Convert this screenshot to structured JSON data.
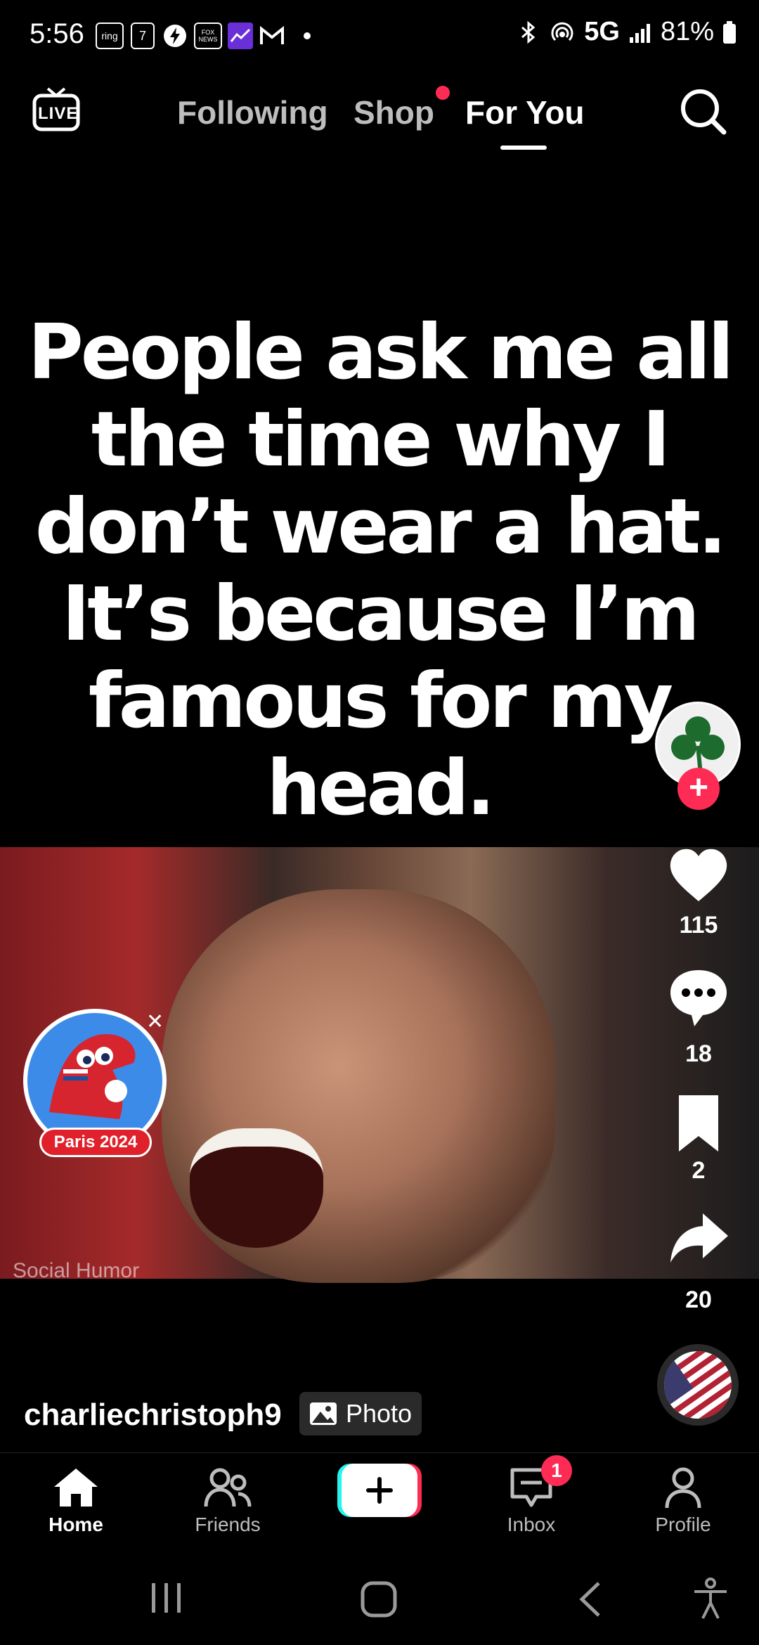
{
  "status_bar": {
    "time": "5:56",
    "notif_icons": [
      "ring-icon",
      "calendar-icon",
      "bolt-icon",
      "fox-news-icon",
      "stocks-icon",
      "gmail-icon",
      "dot-icon"
    ],
    "ring_label": "ring",
    "calendar_day": "7",
    "fox_label": "FOX NEWS",
    "network": "5G",
    "battery": "81%"
  },
  "top_nav": {
    "live_label": "LIVE",
    "tabs": [
      {
        "label": "Following"
      },
      {
        "label": "Shop"
      },
      {
        "label": "For You"
      }
    ],
    "active_tab": "For You"
  },
  "post": {
    "meme_lines": [
      "People ask me all",
      "the time why I",
      "don’t wear a hat.",
      "It’s because I’m",
      "famous for my",
      "head."
    ],
    "watermark": "Social Humor",
    "author": "charliechristoph9",
    "type_chip": "Photo",
    "likes": "115",
    "comments": "18",
    "saves": "2",
    "shares": "20"
  },
  "sticker": {
    "label": "Paris 2024"
  },
  "bottom_nav": {
    "items": [
      {
        "label": "Home"
      },
      {
        "label": "Friends"
      },
      {
        "label": "Inbox"
      },
      {
        "label": "Profile"
      }
    ],
    "inbox_badge": "1"
  },
  "colors": {
    "accent": "#fe2c55",
    "create_cyan": "#25f4ee"
  }
}
